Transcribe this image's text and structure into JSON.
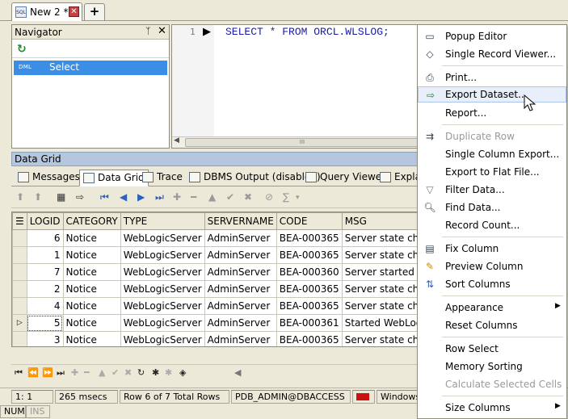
{
  "doc_tab": {
    "icon": "sql-file-icon",
    "label": "New 2 *",
    "add_label": "+"
  },
  "navigator": {
    "title": "Navigator",
    "pin": "ᛉ",
    "close": "✕",
    "refresh": "↻",
    "items": [
      {
        "tag": "DML",
        "label": "Select"
      }
    ]
  },
  "editor": {
    "line": "1",
    "sql": "SELECT * FROM ORCL.WLSLOG;",
    "scroll_left": "◀",
    "scroll_grip": "III"
  },
  "data_grid": {
    "title": "Data Grid",
    "tabs": [
      {
        "label": "Messages"
      },
      {
        "label": "Data Grid"
      },
      {
        "label": "Trace"
      },
      {
        "label": "DBMS Output (disabled)"
      },
      {
        "label": "Query Viewer"
      },
      {
        "label": "Explain Plan"
      }
    ],
    "columns": [
      "LOGID",
      "CATEGORY",
      "TYPE",
      "SERVERNAME",
      "CODE",
      "MSG"
    ],
    "current_row_marker": "▷",
    "rows": [
      [
        "6",
        "Notice",
        "WebLogicServer",
        "AdminServer",
        "BEA-000365",
        "Server state changed to STANDBY"
      ],
      [
        "1",
        "Notice",
        "WebLogicServer",
        "AdminServer",
        "BEA-000365",
        "Server state changed to STARTING"
      ],
      [
        "7",
        "Notice",
        "WebLogicServer",
        "AdminServer",
        "BEA-000360",
        "Server started in RUNNING mode"
      ],
      [
        "2",
        "Notice",
        "WebLogicServer",
        "AdminServer",
        "BEA-000365",
        "Server state changed to ADMIN"
      ],
      [
        "4",
        "Notice",
        "WebLogicServer",
        "AdminServer",
        "BEA-000365",
        "Server state changed to RESUMING"
      ],
      [
        "5",
        "Notice",
        "WebLogicServer",
        "AdminServer",
        "BEA-000361",
        "Started WebLogic AdminServer"
      ],
      [
        "3",
        "Notice",
        "WebLogicServer",
        "AdminServer",
        "BEA-000365",
        "Server state changed to RUNNING"
      ]
    ]
  },
  "status": {
    "position": "1:  1",
    "elapsed": "265 msecs",
    "row_info": "Row 6 of 7 Total Rows",
    "connection": "PDB_ADMIN@DBACCESS",
    "auth": "Windows",
    "num": "NUM",
    "ins": "INS"
  },
  "context_menu": {
    "items": [
      {
        "label": "Popup Editor",
        "icon": "popup-editor-icon",
        "enabled": true
      },
      {
        "label": "Single Record Viewer...",
        "icon": "record-viewer-icon",
        "enabled": true
      },
      {
        "label": "Print...",
        "icon": "printer-icon",
        "enabled": true
      },
      {
        "label": "Export Dataset...",
        "icon": "export-icon",
        "enabled": true,
        "hovered": true
      },
      {
        "label": "Report...",
        "icon": "",
        "enabled": true
      },
      {
        "label": "Duplicate Row",
        "icon": "duplicate-row-icon",
        "enabled": false
      },
      {
        "label": "Single Column Export...",
        "icon": "",
        "enabled": true
      },
      {
        "label": "Export to Flat File...",
        "icon": "",
        "enabled": true
      },
      {
        "label": "Filter Data...",
        "icon": "filter-icon",
        "enabled": true
      },
      {
        "label": "Find Data...",
        "icon": "find-icon",
        "enabled": true
      },
      {
        "label": "Record Count...",
        "icon": "",
        "enabled": true
      },
      {
        "label": "Fix Column",
        "icon": "fix-column-icon",
        "enabled": true
      },
      {
        "label": "Preview Column",
        "icon": "preview-column-icon",
        "enabled": true
      },
      {
        "label": "Sort Columns",
        "icon": "sort-columns-icon",
        "enabled": true
      },
      {
        "label": "Appearance",
        "icon": "",
        "enabled": true,
        "submenu": true
      },
      {
        "label": "Reset Columns",
        "icon": "",
        "enabled": true
      },
      {
        "label": "Row Select",
        "icon": "",
        "enabled": true
      },
      {
        "label": "Memory Sorting",
        "icon": "",
        "enabled": true
      },
      {
        "label": "Calculate Selected Cells",
        "icon": "",
        "enabled": false
      },
      {
        "label": "Size Columns",
        "icon": "",
        "enabled": true,
        "submenu": true
      }
    ]
  },
  "colors": {
    "selection": "#3a8ee6",
    "sql_keyword": "#1a1aa6",
    "panel_header": "#b4c7de",
    "chrome": "#ece9d8"
  }
}
